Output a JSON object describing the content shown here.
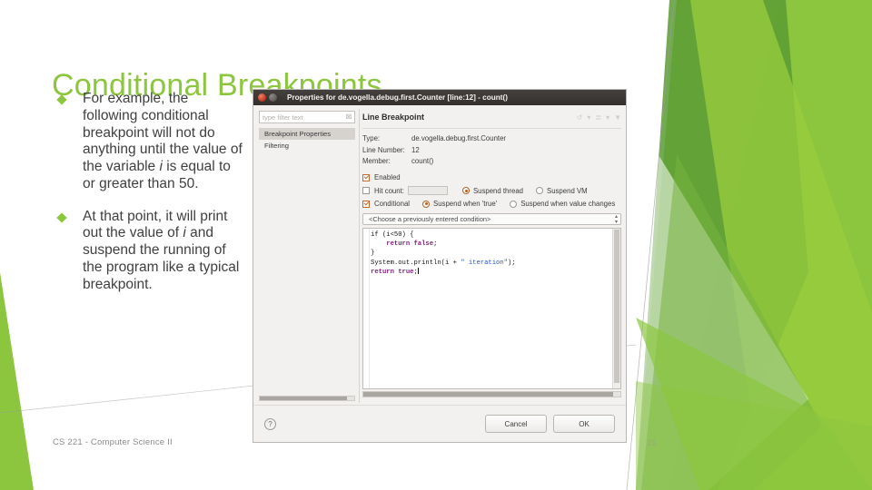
{
  "slide": {
    "title": "Conditional Breakpoints",
    "title_color": "#8CC63E",
    "page_number": "21",
    "footer": "CS 221 - Computer Science II",
    "bullets": [
      "For example, the following conditional breakpoint will not do anything until the value of the variable i is equal to or greater than 50.",
      "At that point, it will print out the value of i and suspend the running of the program like a typical breakpoint."
    ]
  },
  "dialog": {
    "title": "Properties for de.vogella.debug.first.Counter [line:12] - count()",
    "window_buttons": [
      "close-button",
      "minimize-button"
    ],
    "filter": {
      "placeholder": "type filter text",
      "clear_icon": "☒"
    },
    "tree_items": [
      {
        "label": "Breakpoint Properties",
        "selected": true
      },
      {
        "label": "Filtering",
        "selected": false
      }
    ],
    "panel": {
      "heading": "Line Breakpoint",
      "toolbar_icons": [
        "restore-icon",
        "chevron-down-icon",
        "menu-icon",
        "chevron-down-icon",
        "view-menu-icon"
      ]
    },
    "properties": [
      {
        "key": "Type:",
        "value": "de.vogella.debug.first.Counter"
      },
      {
        "key": "Line Number:",
        "value": "12"
      },
      {
        "key": "Member:",
        "value": "count()"
      }
    ],
    "options": {
      "enabled": {
        "label": "Enabled",
        "checked": true
      },
      "hit_count": {
        "label": "Hit count:",
        "checked": false,
        "value": ""
      },
      "suspend_thread": {
        "label": "Suspend thread",
        "selected": true
      },
      "suspend_vm": {
        "label": "Suspend VM",
        "selected": false
      },
      "conditional": {
        "label": "Conditional",
        "checked": true
      },
      "suspend_when_true": {
        "label": "Suspend when 'true'",
        "selected": true
      },
      "suspend_when_value_changes": {
        "label": "Suspend when value changes",
        "selected": false
      }
    },
    "condition_combo": {
      "label": "<Choose a previously entered condition>"
    },
    "code_lines": [
      {
        "segments": [
          {
            "t": "if (i<50) {",
            "c": "plain"
          }
        ]
      },
      {
        "segments": [
          {
            "t": "    ",
            "c": "plain"
          },
          {
            "t": "return",
            "c": "kw"
          },
          {
            "t": " ",
            "c": "plain"
          },
          {
            "t": "false",
            "c": "kw"
          },
          {
            "t": ";",
            "c": "plain"
          }
        ]
      },
      {
        "segments": [
          {
            "t": "}",
            "c": "plain"
          }
        ]
      },
      {
        "segments": [
          {
            "t": "System.out.println(i + ",
            "c": "plain"
          },
          {
            "t": "\" iteration\"",
            "c": "st"
          },
          {
            "t": ");",
            "c": "plain"
          }
        ]
      },
      {
        "segments": [
          {
            "t": "return",
            "c": "kw"
          },
          {
            "t": " ",
            "c": "plain"
          },
          {
            "t": "true",
            "c": "kw"
          },
          {
            "t": ";",
            "c": "plain"
          }
        ],
        "caret": true
      }
    ],
    "footer": {
      "help_icon": "?",
      "cancel_label": "Cancel",
      "ok_label": "OK"
    }
  }
}
